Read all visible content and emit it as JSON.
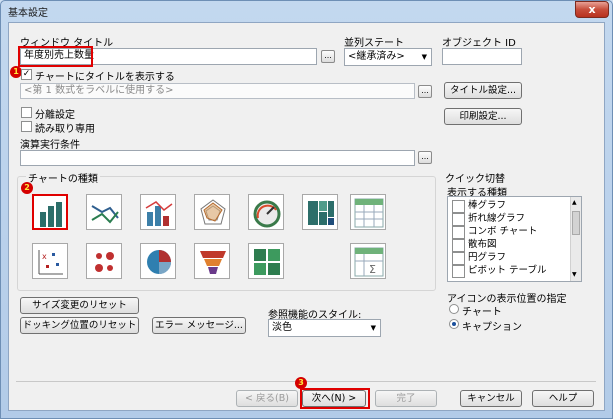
{
  "window": {
    "title": "基本設定",
    "close_glyph": "x"
  },
  "window_title_label": "ウィンドウ タイトル",
  "window_title_value": "年度別売上数量",
  "ellipsis": "...",
  "sort_state_label": "並列ステート",
  "sort_state_value": "<継承済み>",
  "object_id_label": "オブジェクト ID",
  "object_id_value": "",
  "show_title_checkbox_label": "チャートにタイトルを表示する",
  "chart_title_placeholder": "<第 1 数式をラベルに使用する>",
  "title_settings_button": "タイトル設定...",
  "detach_label": "分離設定",
  "readonly_label": "読み取り専用",
  "print_settings_button": "印刷設定...",
  "calc_condition_label": "演算実行条件",
  "chart_type_label": "チャートの種類",
  "quick_switch_label": "クイック切替",
  "display_types_label": "表示する種類",
  "display_types": [
    "棒グラフ",
    "折れ線グラフ",
    "コンボ チャート",
    "散布図",
    "円グラフ",
    "ピボット テーブル"
  ],
  "reset_size_button": "サイズ変更のリセット",
  "reset_docking_button": "ドッキング位置のリセット",
  "error_message_button": "エラー メッセージ...",
  "ref_style_label": "参照機能のスタイル:",
  "ref_style_value": "淡色",
  "icon_position_label": "アイコンの表示位置の指定",
  "radio_chart_label": "チャート",
  "radio_caption_label": "キャプション",
  "back_button": "< 戻る(B)",
  "next_button": "次へ(N) >",
  "finish_button": "完了",
  "cancel_button": "キャンセル",
  "help_button": "ヘルプ",
  "markers": {
    "m1": "1",
    "m2": "2",
    "m3": "3"
  },
  "colors": {
    "accent_red": "#e00000",
    "window_blue": "#c3d8ef"
  },
  "icons": [
    "bar-chart-icon",
    "line-chart-icon",
    "combo-chart-icon",
    "radar-chart-icon",
    "gauge-chart-icon",
    "mekko-chart-icon",
    "grid-chart-icon",
    "scatter-chart-icon",
    "bubble-grid-chart-icon",
    "pie-chart-icon",
    "funnel-chart-icon",
    "block-chart-icon",
    "pivot-table-icon"
  ]
}
